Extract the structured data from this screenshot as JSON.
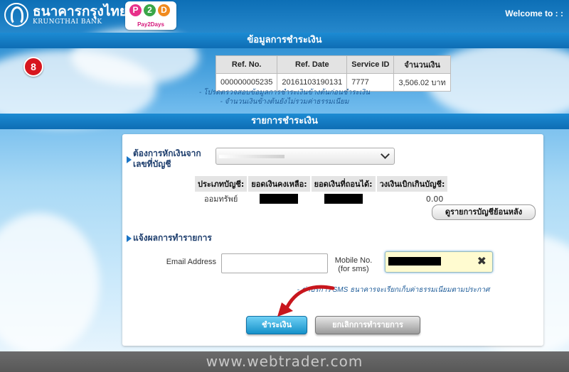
{
  "header": {
    "bank_name_th": "ธนาคารกรุงไทย",
    "bank_name_en": "KRUNGTHAI BANK",
    "p2d_letters": [
      "P",
      "2",
      "D"
    ],
    "p2d_colors": [
      "#e8308a",
      "#3aa648",
      "#f18a1e"
    ],
    "p2d_tagline": "Pay2Days",
    "welcome": "Welcome to : :"
  },
  "step_badge": "8",
  "payment_info": {
    "heading": "ข้อมูลการชำระเงิน",
    "columns": [
      "Ref. No.",
      "Ref. Date",
      "Service ID",
      "จำนวนเงิน"
    ],
    "row": [
      "000000005235",
      "20161103190131",
      "7777",
      "3,506.02 บาท"
    ],
    "notes": [
      "- โปรดตรวจสอบข้อมูลการชำระเงินข้างต้นก่อนชำระเงิน",
      "- จำนวนเงินข้างต้นยังไม่รวมค่าธรรมเนียม"
    ]
  },
  "payment_list": {
    "heading": "รายการชำระเงิน",
    "debit_label_line1": "ต้องการหักเงินจาก",
    "debit_label_line2": "เลขที่บัญชี",
    "account_select_value": "",
    "account_columns": [
      "ประเภทบัญชี:",
      "ยอดเงินคงเหลือ:",
      "ยอดเงินที่ถอนได้:",
      "วงเงินเบิกเกินบัญชี:"
    ],
    "account_row": {
      "type": "ออมทรัพย์",
      "overdraft": "0.00"
    },
    "history_button": "ดูรายการบัญชีย้อนหลัง",
    "notify_label": "แจ้งผลการทำรายการ",
    "email_label": "Email Address",
    "email_value": "",
    "mobile_label_line1": "Mobile No.",
    "mobile_label_line2": "(for sms)",
    "clear_symbol": "✖",
    "fee_note": "- ค่าบริการ SMS ธนาคารจะเรียกเก็บค่าธรรมเนียมตามประกาศ",
    "pay_button": "ชำระเงิน",
    "cancel_button": "ยกเลิกการทำรายการ"
  },
  "watermark": "www.webtrader.com",
  "colors": {
    "band": "#1578c3",
    "accent_arrow": "#c8161d",
    "pay_button": "#28a6dc"
  }
}
